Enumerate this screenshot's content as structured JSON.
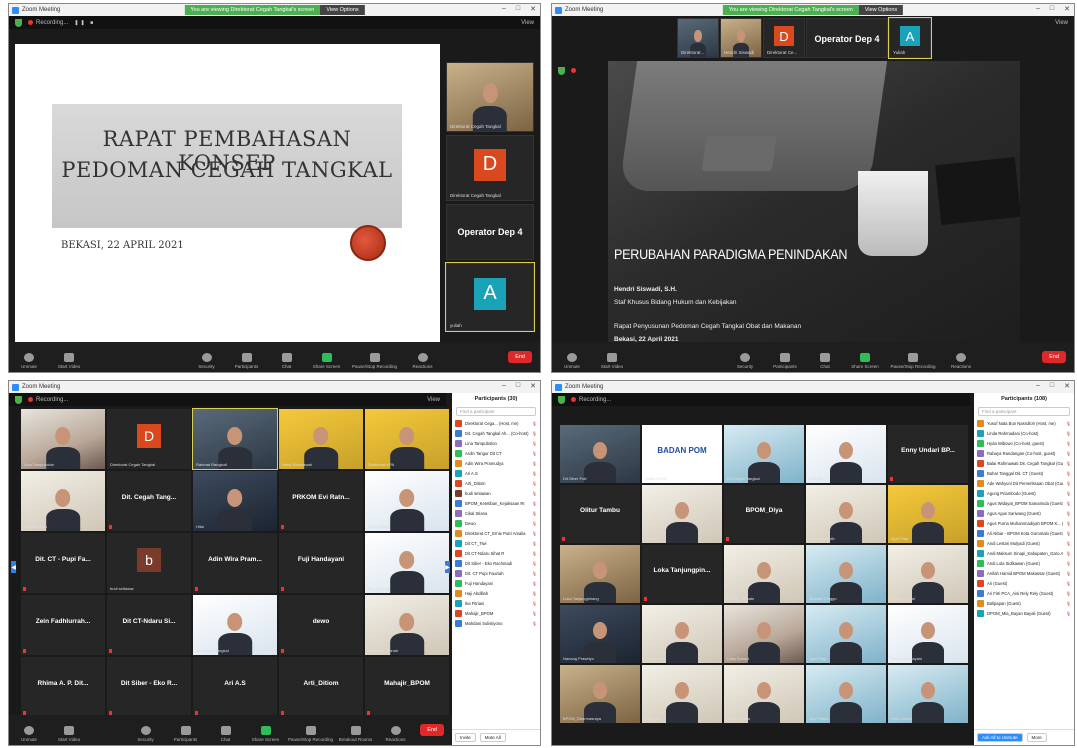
{
  "app": {
    "window_title": "Zoom Meeting",
    "share_banner": "You are viewing Direktorat Cegah Tangkal's screen",
    "view_options": "View Options",
    "recording": "Recording...",
    "view": "View"
  },
  "toolbar": {
    "unmute": "Unmute",
    "start_video": "Start Video",
    "security": "Security",
    "participants": "Participants",
    "chat": "Chat",
    "share_screen": "Share Screen",
    "pause_recording": "Pause/Stop Recording",
    "breakout": "Breakout Rooms",
    "reactions": "Reactions",
    "end": "End"
  },
  "window1": {
    "slide_title_line1": "RAPAT PEMBAHASAN KONSEP",
    "slide_title_line2": "PEDOMAN CEGAH TANGKAL",
    "slide_date": "BEKASI, 22 APRIL 2021",
    "tiles": [
      {
        "name": "Direktorat Cegah Tangkal",
        "letter": ""
      },
      {
        "name": "Direktorat Cegah Tangkal",
        "letter": "D"
      },
      {
        "name": "",
        "big": "Operator Dep 4"
      },
      {
        "name": "yuliah",
        "letter": "A"
      }
    ]
  },
  "window2": {
    "strip": [
      {
        "name": "Direktorat..."
      },
      {
        "name": "Hendri Siswadi"
      },
      {
        "name": "Direktorat Ce...",
        "letter": "D"
      },
      {
        "name": "",
        "big": "Operator Dep 4"
      },
      {
        "name": "Yuliah",
        "letter": "A"
      }
    ],
    "slide_title": "PERUBAHAN PARADIGMA PENINDAKAN",
    "speaker": "Hendri Siswadi, S.H.",
    "speaker_role": "Staf Khusus Bidang Hukum dan Kebijakan",
    "event": "Rapat Penyusunan Pedoman Cegah Tangkal Obat dan Makanan",
    "event_date": "Bekasi, 22 April 2021"
  },
  "window3": {
    "participants_header": "Participants (30)",
    "search_placeholder": "Find a participant",
    "gallery": [
      {
        "name": "Lina Tampubolon",
        "cam": "cam-a"
      },
      {
        "name": "Direktorat Cegah Tangkal",
        "letter": "D"
      },
      {
        "name": "Rahmat Rangkuti",
        "cam": "cam-b",
        "hl": true
      },
      {
        "name": "Neny Rahmawati",
        "cam": "cam-d"
      },
      {
        "name": "Direktorat KPA",
        "cam": "cam-d"
      },
      {
        "name": "Sahlan Lubis",
        "cam": "cam-c"
      },
      {
        "name": "",
        "big": "Dit. Cegah Tang..."
      },
      {
        "name": "Hilal",
        "cam": "cam-f"
      },
      {
        "name": "",
        "big": "PRKOM Evi Ratn..."
      },
      {
        "name": "Cikal Stiana",
        "cam": "cam-e"
      },
      {
        "name": "",
        "big": "Dit. CT - Pupi Fa..."
      },
      {
        "name": "budi setiawan",
        "letter": "b"
      },
      {
        "name": "",
        "big": "Adin Wira Pram..."
      },
      {
        "name": "",
        "big": "Fuji Handayani"
      },
      {
        "name": "Ary Tanjung",
        "cam": "cam-e"
      },
      {
        "name": "",
        "big": "Zein Fadhlurrah..."
      },
      {
        "name": "",
        "big": "Dit CT-Ndaru Si..."
      },
      {
        "name": "Dit.Cegah Tangkal",
        "cam": "cam-e"
      },
      {
        "name": "",
        "big": "dewo"
      },
      {
        "name": "Wardatul Jannah",
        "cam": "cam-c"
      },
      {
        "name": "",
        "big": "Rhima A. P. Dit..."
      },
      {
        "name": "",
        "big": "Dit Siber - Eko R..."
      },
      {
        "name": "",
        "big": "Ari A.S"
      },
      {
        "name": "",
        "big": "Arti_Ditiom"
      },
      {
        "name": "",
        "big": "Mahajir_BPOM"
      }
    ],
    "participants": [
      {
        "name": "Direktorat Cega... (Host, me)",
        "color": "#d9481e"
      },
      {
        "name": "Dit. Cegah Tangkal Ah... (Co-host)",
        "color": "#3a7bd5"
      },
      {
        "name": "Lina Tampubolon",
        "color": "#8e6bbf"
      },
      {
        "name": "Ardin Tangur Dit CT",
        "color": "#2ebd59"
      },
      {
        "name": "Adin Wira Pramudya",
        "color": "#e08a1f"
      },
      {
        "name": "Ari A.S",
        "color": "#1aa2b8"
      },
      {
        "name": "Arti_Ditiom",
        "color": "#d9481e"
      },
      {
        "name": "budi setiawan",
        "color": "#7a3b2a"
      },
      {
        "name": "BPOM_Ketetiban_Kejaksaan RI",
        "color": "#3a7bd5"
      },
      {
        "name": "Cikal Stiana",
        "color": "#8e6bbf"
      },
      {
        "name": "Dewo",
        "color": "#2ebd59"
      },
      {
        "name": "Direktorat CT_Ernie Putri Amalia",
        "color": "#e08a1f"
      },
      {
        "name": "Dit CT_Tiwi",
        "color": "#1aa2b8"
      },
      {
        "name": "Dit CT-Ndaru Sihat R",
        "color": "#d9481e"
      },
      {
        "name": "Dit Siber - Eko Rachmadi",
        "color": "#3a7bd5"
      },
      {
        "name": "Dit. CT Pupi Fauziah",
        "color": "#8e6bbf"
      },
      {
        "name": "Fuji Handayani",
        "color": "#2ebd59"
      },
      {
        "name": "Haji Abdillah",
        "color": "#e08a1f"
      },
      {
        "name": "Ika Fitriani",
        "color": "#1aa2b8"
      },
      {
        "name": "Mahajir_BPOM",
        "color": "#d9481e"
      },
      {
        "name": "Mahdani Sulistiyono",
        "color": "#3a7bd5"
      }
    ],
    "invite": "Invite",
    "mute_all": "Mute All"
  },
  "window4": {
    "participants_header": "Participants (108)",
    "search_placeholder": "Find a participant",
    "gallery": [
      {
        "name": "Dit.Siber Polri",
        "cam": "cam-b"
      },
      {
        "name": "Badan POM",
        "logo": "BADAN POM"
      },
      {
        "name": "Dit.Cegah Tangkal",
        "cam": "cam-g"
      },
      {
        "name": "Dit.KPA",
        "cam": "cam-e"
      },
      {
        "name": "",
        "big": "Enny Undari BP..."
      },
      {
        "name": "",
        "big": "Olitur Tambu"
      },
      {
        "name": "Ni Putu",
        "cam": "cam-c"
      },
      {
        "name": "",
        "big": "BPOM_Diya"
      },
      {
        "name": "Asep Jaenudin",
        "cam": "cam-c"
      },
      {
        "name": "Apel Pagi",
        "cam": "cam-d"
      },
      {
        "name": "Loka Tanjungpinang",
        "cam": "cam-h"
      },
      {
        "name": "",
        "big": "Loka Tanjungpin..."
      },
      {
        "name": "BPOM_Ternate",
        "cam": "cam-c"
      },
      {
        "name": "Michael Ringgo",
        "cam": "cam-g"
      },
      {
        "name": "Balai Tangkal",
        "cam": "cam-c"
      },
      {
        "name": "Nanang Prasetyo",
        "cam": "cam-f"
      },
      {
        "name": "Leni Krisna",
        "cam": "cam-c"
      },
      {
        "name": "Loka Sampit",
        "cam": "cam-a"
      },
      {
        "name": "Apel Pagi",
        "cam": "cam-g"
      },
      {
        "name": "Retno Handayani",
        "cam": "cam-e"
      },
      {
        "name": "BPOM_Dharmasraya",
        "cam": "cam-h"
      },
      {
        "name": "Banggai",
        "cam": "cam-c"
      },
      {
        "name": "Eiwy Ponaila",
        "cam": "cam-c"
      },
      {
        "name": "Ayu Pratiwi",
        "cam": "cam-g"
      },
      {
        "name": "Heny Utami",
        "cam": "cam-g"
      }
    ],
    "participants": [
      {
        "name": "Yusuf Nata Bun Nasrulloh (Host, me)",
        "color": "#e08a1f"
      },
      {
        "name": "Linda Rahmadani (Co-host)",
        "color": "#1aa2b8"
      },
      {
        "name": "Hyda Wibowo (Co-host, guest)",
        "color": "#2ebd59"
      },
      {
        "name": "Rabaya Randangan (Co-host, guest)",
        "color": "#8e6bbf"
      },
      {
        "name": "Balai Rahmawati Dit. Cegah Tangkal (Guest)",
        "color": "#d9481e"
      },
      {
        "name": "Bahar Tanggal Dit. CT (Guest)",
        "color": "#3a7bd5"
      },
      {
        "name": "Ade Wahyuni Dit Pemeriksaan Obat (Guest)",
        "color": "#e08a1f"
      },
      {
        "name": "Agung Priambodo (Guest)",
        "color": "#1aa2b8"
      },
      {
        "name": "Agus Widayat_BPOM Samarinda (Guest)",
        "color": "#2ebd59"
      },
      {
        "name": "Agus Agus Sariwang (Guest)",
        "color": "#8e6bbf"
      },
      {
        "name": "Agus Purna Muhammadiyah BPOM K... (Guest)",
        "color": "#d9481e"
      },
      {
        "name": "Ali Akbar - BPOM Kota Gorontalo (Guest)",
        "color": "#3a7bd5"
      },
      {
        "name": "Andi Lestari Mulyadi (Guest)",
        "color": "#e08a1f"
      },
      {
        "name": "Andi Maksum Sinapi_Kabupaten_Garo.A... (Guest)",
        "color": "#1aa2b8"
      },
      {
        "name": "Andi Lola Sidikawan (Guest)",
        "color": "#2ebd59"
      },
      {
        "name": "Anifah Hamid BPOM Makassar (Guest)",
        "color": "#8e6bbf"
      },
      {
        "name": "Ari (Guest)",
        "color": "#d9481e"
      },
      {
        "name": "Ari Fitri PCA_Aisi Rely Rely (Guest)",
        "color": "#3a7bd5"
      },
      {
        "name": "Balipapan (Guest)",
        "color": "#e08a1f"
      },
      {
        "name": "DPOM_Mia_Bayan Bayali (Guest)",
        "color": "#1aa2b8"
      }
    ],
    "ask_unmute": "Ask All to Unmute",
    "more": "More"
  }
}
